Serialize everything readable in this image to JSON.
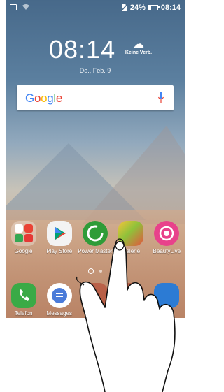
{
  "status_bar": {
    "battery_percent": "24%",
    "time": "08:14",
    "battery_level": 0.24
  },
  "lock_widget": {
    "time": "08:14",
    "weather": "Keine Verb.",
    "date": "Do., Feb. 9"
  },
  "search": {
    "logo_text": "Google"
  },
  "apps_row": [
    {
      "label": "Google",
      "icon": "google-folder-icon"
    },
    {
      "label": "Play Store",
      "icon": "play-store-icon"
    },
    {
      "label": "Power Master",
      "icon": "power-master-icon"
    },
    {
      "label": "Galerie",
      "icon": "gallery-icon"
    },
    {
      "label": "BeautyLive",
      "icon": "beautylive-icon"
    }
  ],
  "dock": [
    {
      "label": "Telefon",
      "icon": "phone-icon"
    },
    {
      "label": "Messages",
      "icon": "messages-icon"
    },
    {
      "label": "",
      "icon": "hidden-app-icon"
    },
    {
      "label": "",
      "icon": "hidden-app-icon"
    },
    {
      "label": "",
      "icon": "camera-icon"
    }
  ],
  "colors": {
    "accent_mic": "#1a73e8",
    "google_blue": "#4285F4",
    "google_red": "#EA4335",
    "google_yellow": "#FBBC05",
    "google_green": "#34A853"
  }
}
